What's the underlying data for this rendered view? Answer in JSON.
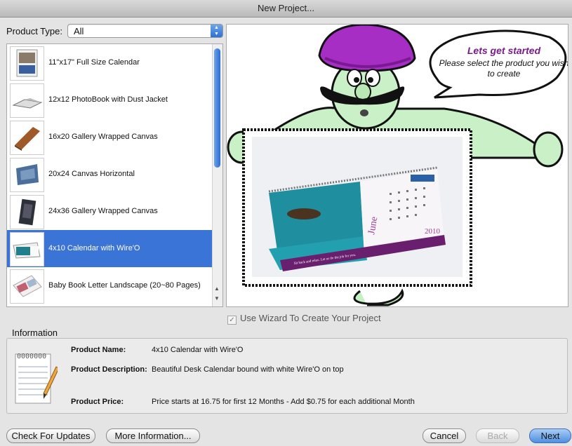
{
  "window": {
    "title": "New Project..."
  },
  "product_type": {
    "label": "Product Type:",
    "selected": "All"
  },
  "products": [
    {
      "label": "11\"x17\" Full Size Calendar",
      "selected": false
    },
    {
      "label": "12x12 PhotoBook with Dust Jacket",
      "selected": false
    },
    {
      "label": "16x20 Gallery Wrapped Canvas",
      "selected": false
    },
    {
      "label": "20x24 Canvas Horizontal",
      "selected": false
    },
    {
      "label": "24x36 Gallery Wrapped Canvas",
      "selected": false
    },
    {
      "label": "4x10 Calendar with Wire'O",
      "selected": true
    },
    {
      "label": "Baby Book Letter Landscape (20~80 Pages)",
      "selected": false
    }
  ],
  "preview": {
    "bubble_title": "Lets get started",
    "bubble_text": "Please select the product you wish to create",
    "calendar_month": "June",
    "calendar_year": "2010",
    "calendar_tagline": "Sit back and relax. Let us do the job for you."
  },
  "wizard": {
    "label": "Use Wizard To Create Your Project",
    "checked": true
  },
  "information": {
    "title": "Information",
    "name_label": "Product Name:",
    "name_value": "4x10 Calendar with Wire'O",
    "description_label": "Product Description:",
    "description_value": "Beautiful Desk Calendar bound with white Wire'O on top",
    "price_label": "Product Price:",
    "price_value": "Price starts at 16.75 for first 12 Months - Add $0.75 for each additional Month"
  },
  "buttons": {
    "check_updates": "Check For Updates",
    "more_info": "More Information...",
    "cancel": "Cancel",
    "back": "Back",
    "next": "Next"
  }
}
